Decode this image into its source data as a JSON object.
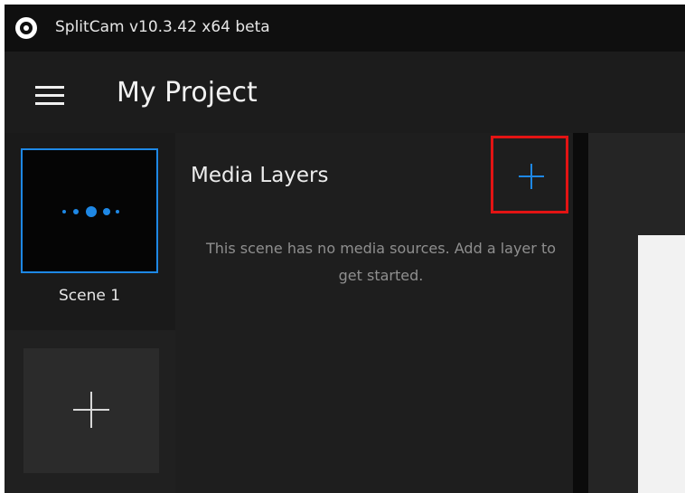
{
  "titlebar": {
    "app_title": "SplitCam v10.3.42 x64 beta",
    "logo_icon": "splitcam-logo-icon"
  },
  "header": {
    "menu_icon": "hamburger-icon",
    "project_title": "My Project"
  },
  "scenes": {
    "items": [
      {
        "label": "Scene 1",
        "selected": true
      }
    ],
    "add_scene_icon": "plus-icon"
  },
  "media_layers": {
    "title": "Media Layers",
    "add_icon": "plus-icon",
    "empty_message": "This scene has no media sources. Add a layer to get started."
  },
  "colors": {
    "accent": "#1e88e5",
    "highlight_box": "#e31414",
    "background": "#1e1e1e",
    "titlebar": "#0f0f0f"
  }
}
